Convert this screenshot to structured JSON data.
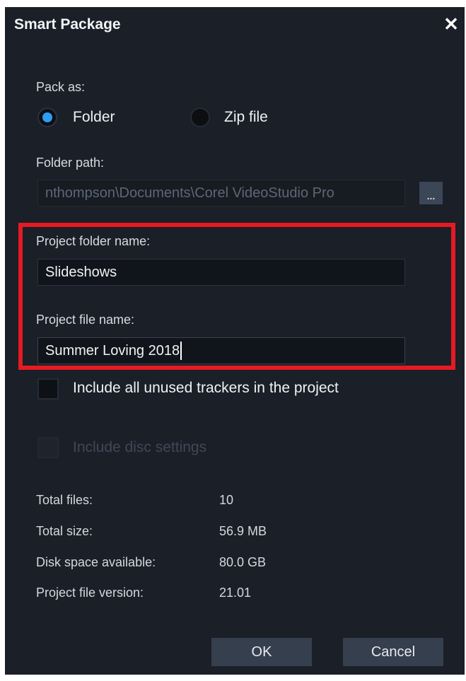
{
  "dialog": {
    "title": "Smart Package",
    "close_glyph": "✕"
  },
  "pack_as": {
    "label": "Pack as:",
    "options": [
      {
        "label": "Folder",
        "selected": true
      },
      {
        "label": "Zip file",
        "selected": false
      }
    ]
  },
  "folder_path": {
    "label": "Folder path:",
    "value": "nthompson\\Documents\\Corel VideoStudio Pro",
    "browse_label": "..."
  },
  "project_folder": {
    "label": "Project folder name:",
    "value": "Slideshows"
  },
  "project_file": {
    "label": "Project file name:",
    "value": "Summer Loving 2018"
  },
  "options": {
    "include_trackers": {
      "label": "Include all unused trackers in the project",
      "checked": false
    },
    "include_disc": {
      "label": "Include disc settings",
      "checked": false,
      "disabled": true
    }
  },
  "stats": [
    {
      "label": "Total files:",
      "value": "10"
    },
    {
      "label": "Total size:",
      "value": "56.9 MB"
    },
    {
      "label": "Disk space available:",
      "value": "80.0 GB"
    },
    {
      "label": "Project file version:",
      "value": "21.01"
    }
  ],
  "buttons": {
    "ok": "OK",
    "cancel": "Cancel"
  },
  "colors": {
    "background": "#1b1f27",
    "accent": "#2f9cf3",
    "highlight_border": "#e51a22",
    "button": "#353f4e"
  },
  "icons": {
    "close": "close-icon",
    "radio_selected": "radio-selected-icon",
    "radio_unselected": "radio-unselected-icon"
  }
}
